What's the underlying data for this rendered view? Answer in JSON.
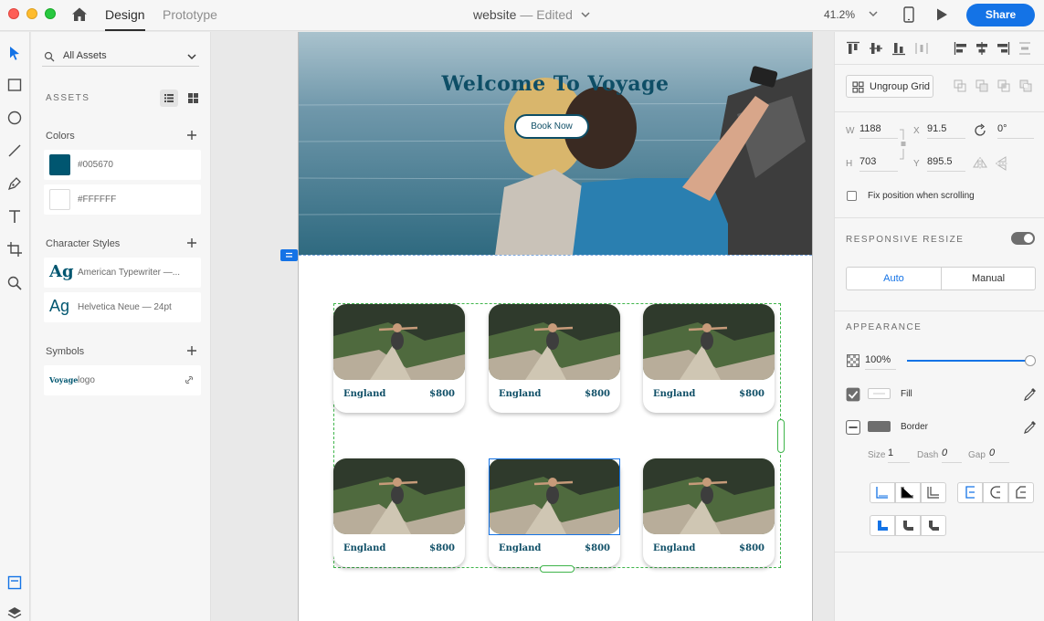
{
  "titlebar": {
    "tab_design": "Design",
    "tab_prototype": "Prototype",
    "doc_name": "website",
    "doc_sep": " — ",
    "doc_status": "Edited",
    "zoom": "41.2%",
    "share": "Share"
  },
  "assets": {
    "filter": "All Assets",
    "heading": "ASSETS",
    "colors_label": "Colors",
    "colors": [
      {
        "hex": "#005670",
        "label": "#005670"
      },
      {
        "hex": "#FFFFFF",
        "label": "#FFFFFF"
      }
    ],
    "char_styles_label": "Character Styles",
    "char_styles": [
      {
        "glyph": "Ag",
        "label": "American Typewriter —..."
      },
      {
        "glyph": "Ag",
        "label": "Helvetica Neue — 24pt"
      }
    ],
    "symbols_label": "Symbols",
    "symbols": [
      {
        "thumb": "Voyage",
        "label": "logo"
      }
    ]
  },
  "canvas": {
    "hero_title": "Welcome To Voyage",
    "book_now": "Book Now",
    "cards": [
      {
        "name": "England",
        "price": "$800"
      },
      {
        "name": "England",
        "price": "$800"
      },
      {
        "name": "England",
        "price": "$800"
      },
      {
        "name": "England",
        "price": "$800"
      },
      {
        "name": "England",
        "price": "$800"
      },
      {
        "name": "England",
        "price": "$800"
      }
    ]
  },
  "props": {
    "ungroup": "Ungroup Grid",
    "w_label": "W",
    "w": "1188",
    "h_label": "H",
    "h": "703",
    "x_label": "X",
    "x": "91.5",
    "y_label": "Y",
    "y": "895.5",
    "rotation": "0°",
    "fix_position": "Fix position when scrolling",
    "responsive_resize": "RESPONSIVE RESIZE",
    "auto": "Auto",
    "manual": "Manual",
    "appearance": "APPEARANCE",
    "opacity": "100%",
    "fill": "Fill",
    "border": "Border",
    "size_label": "Size",
    "size": "1",
    "dash_label": "Dash",
    "dash": "0",
    "gap_label": "Gap",
    "gap": "0"
  },
  "colors": {
    "accent": "#1473e6",
    "brand": "#005670",
    "group_guide": "#3fb54b"
  }
}
